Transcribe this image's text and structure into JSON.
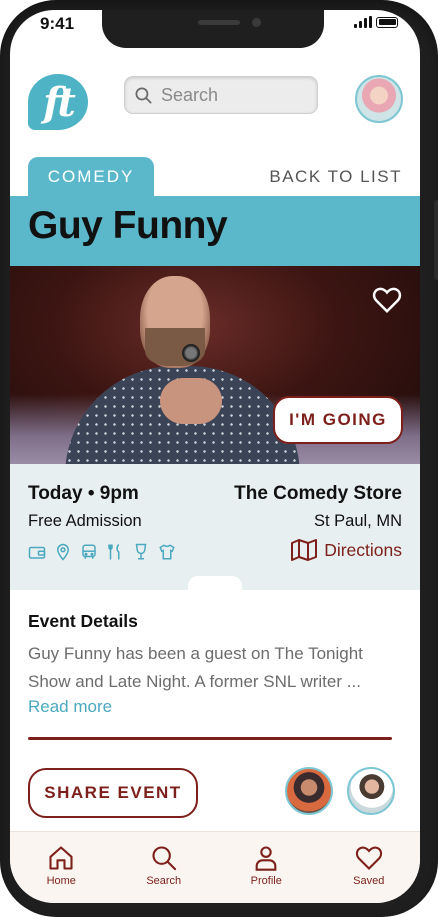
{
  "status_bar": {
    "time": "9:41"
  },
  "header": {
    "logo_text": "ft",
    "search": {
      "placeholder": "Search",
      "value": ""
    }
  },
  "event": {
    "category": "COMEDY",
    "back_label": "BACK TO LIST",
    "title": "Guy Funny",
    "going_label": "I'M GOING",
    "when": "Today • 9pm",
    "admission": "Free Admission",
    "venue": "The Comedy Store",
    "city": "St Paul, MN",
    "directions_label": "Directions",
    "amenity_icons": [
      "wallet-icon",
      "location-pin-icon",
      "bus-icon",
      "utensils-icon",
      "wine-glass-icon",
      "tshirt-icon"
    ]
  },
  "details": {
    "heading": "Event Details",
    "body": "Guy Funny has been a guest on The Tonight Show and Late Night. A former SNL writer ...",
    "read_more": "Read more"
  },
  "actions": {
    "share_label": "SHARE EVENT"
  },
  "tab_bar": {
    "items": [
      {
        "label": "Home",
        "icon": "home-icon"
      },
      {
        "label": "Search",
        "icon": "search-icon"
      },
      {
        "label": "Profile",
        "icon": "person-icon"
      },
      {
        "label": "Saved",
        "icon": "heart-icon"
      }
    ]
  },
  "colors": {
    "accent_teal": "#5bb8cb",
    "brand_maroon": "#7d1f1a",
    "info_panel_bg": "#e8eff1"
  }
}
